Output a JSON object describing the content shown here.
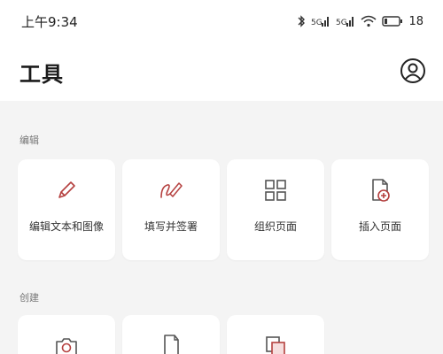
{
  "status_bar": {
    "time": "上午9:34",
    "battery_percent": "18",
    "icons": [
      "bluetooth-icon",
      "signal-icon",
      "signal-icon",
      "wifi-icon",
      "battery-icon"
    ]
  },
  "header": {
    "title": "工具",
    "account_icon": "account-icon"
  },
  "sections": [
    {
      "label": "编辑",
      "tools": [
        {
          "label": "编辑文本和图像",
          "icon": "pencil-icon"
        },
        {
          "label": "填写并签署",
          "icon": "sign-icon"
        },
        {
          "label": "组织页面",
          "icon": "grid-icon"
        },
        {
          "label": "插入页面",
          "icon": "insert-page-icon"
        }
      ]
    },
    {
      "label": "创建",
      "tools": [
        {
          "label": "",
          "icon": "camera-icon"
        },
        {
          "label": "",
          "icon": "document-icon"
        },
        {
          "label": "",
          "icon": "combine-icon"
        }
      ]
    }
  ],
  "colors": {
    "accent": "#b5403f",
    "background": "#f4f4f4",
    "card": "#ffffff"
  }
}
